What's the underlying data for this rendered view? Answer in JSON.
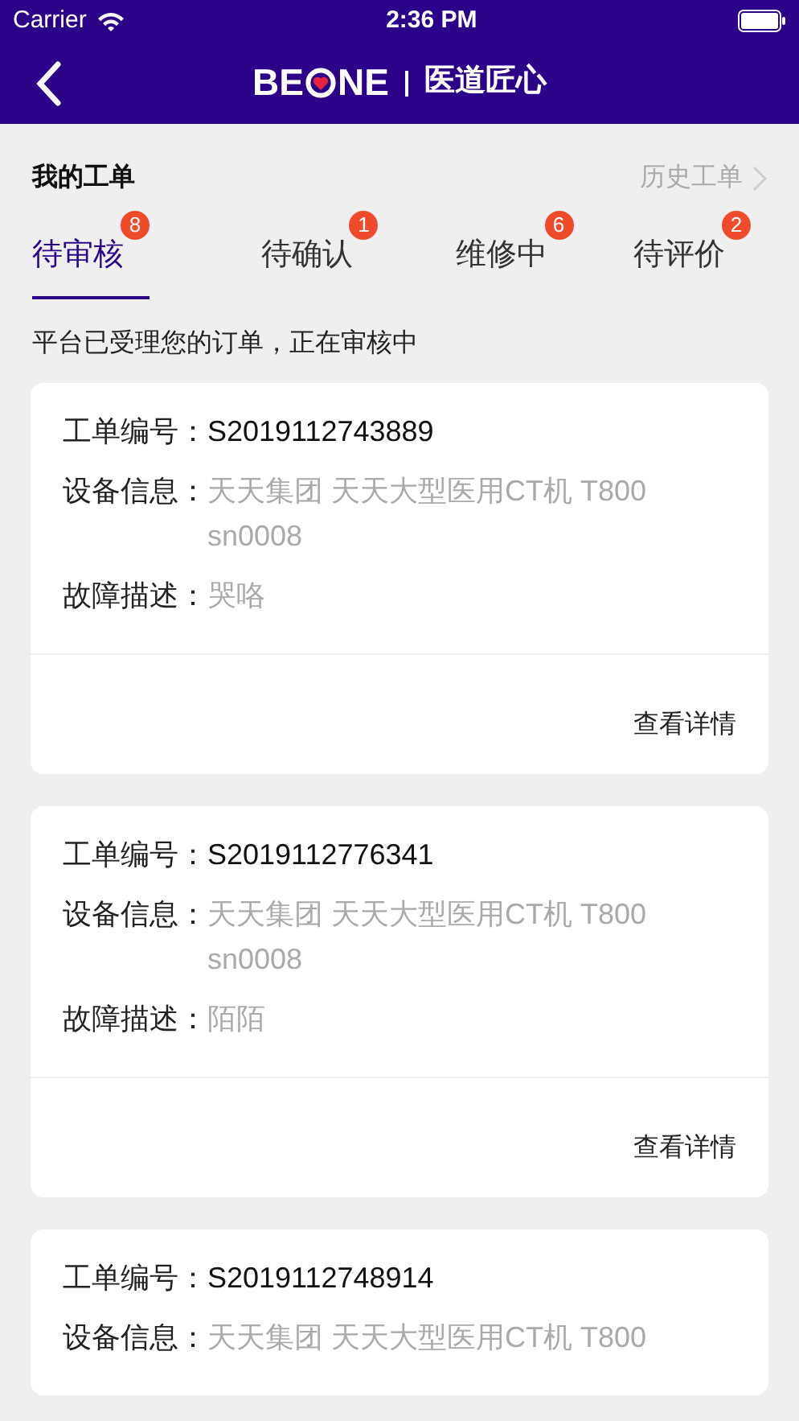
{
  "status_bar": {
    "carrier": "Carrier",
    "time": "2:36 PM"
  },
  "nav": {
    "logo_start": "BE",
    "logo_end": "NE",
    "slogan": "医道匠心"
  },
  "section": {
    "title": "我的工单",
    "history_link": "历史工单"
  },
  "tabs": [
    {
      "label": "待审核",
      "badge": "8",
      "selected": true
    },
    {
      "label": "待确认",
      "badge": "1",
      "selected": false
    },
    {
      "label": "维修中",
      "badge": "6",
      "selected": false
    },
    {
      "label": "待评价",
      "badge": "2",
      "selected": false
    }
  ],
  "notice": "平台已受理您的订单，正在审核中",
  "orders": [
    {
      "fields": [
        {
          "label": "工单编号：",
          "value": "S2019112743889",
          "kind": "id"
        },
        {
          "label": "设备信息：",
          "value": "天天集团 天天大型医用CT机 T800 sn0008",
          "kind": "info"
        },
        {
          "label": "故障描述：",
          "value": "哭咯",
          "kind": "info"
        }
      ],
      "action": "查看详情"
    },
    {
      "fields": [
        {
          "label": "工单编号：",
          "value": "S2019112776341",
          "kind": "id"
        },
        {
          "label": "设备信息：",
          "value": "天天集团 天天大型医用CT机 T800 sn0008",
          "kind": "info"
        },
        {
          "label": "故障描述：",
          "value": "陌陌",
          "kind": "info"
        }
      ],
      "action": "查看详情"
    },
    {
      "fields": [
        {
          "label": "工单编号：",
          "value": "S2019112748914",
          "kind": "id"
        },
        {
          "label": "设备信息：",
          "value": "天天集团 天天大型医用CT机 T800",
          "kind": "info"
        }
      ]
    }
  ]
}
